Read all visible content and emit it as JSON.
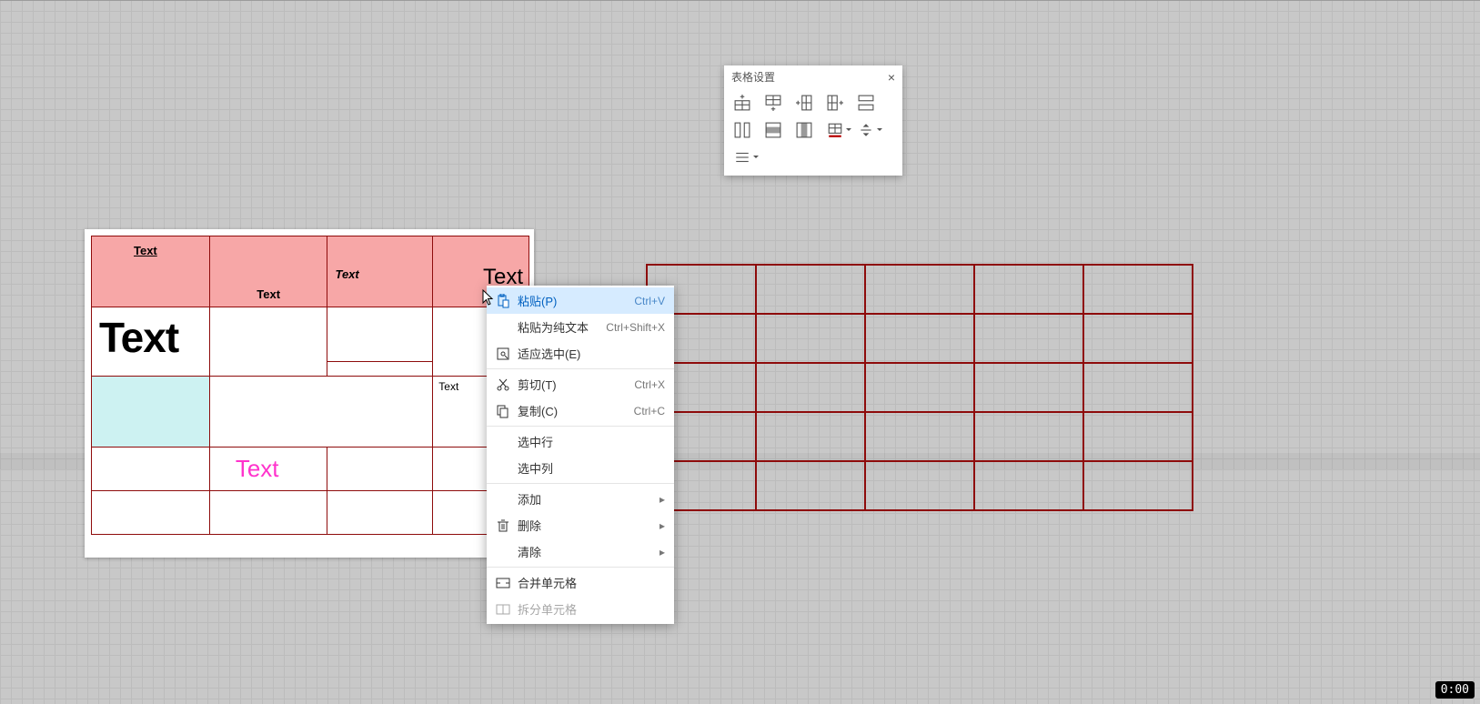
{
  "palette": {
    "title": "表格设置",
    "icons": [
      "insert-row-above-icon",
      "insert-row-below-icon",
      "insert-col-left-icon",
      "insert-col-right-icon",
      "split-horizontal-icon",
      "split-vertical-icon",
      "delete-row-icon",
      "delete-col-icon",
      "border-color-icon",
      "align-vertical-icon",
      "align-horizontal-icon"
    ]
  },
  "left_table": {
    "header": [
      {
        "text": "Text",
        "style": "underline"
      },
      {
        "text": "Text",
        "style": "bottom"
      },
      {
        "text": "Text",
        "style": "italic"
      },
      {
        "text": "Text",
        "style": "large-right"
      }
    ],
    "row2_cell1": "Text",
    "row4_cell4": "Text",
    "row5_cell2": "Text"
  },
  "right_table": {
    "rows": 5,
    "cols": 5
  },
  "context_menu": {
    "items": [
      {
        "icon": "paste-icon",
        "label": "粘贴(P)",
        "kbd": "Ctrl+V",
        "hover": true
      },
      {
        "icon": "",
        "label": "粘贴为纯文本",
        "kbd": "Ctrl+Shift+X"
      },
      {
        "icon": "fit-selection-icon",
        "label": "适应选中(E)",
        "kbd": ""
      },
      {
        "icon": "cut-icon",
        "label": "剪切(T)",
        "kbd": "Ctrl+X"
      },
      {
        "icon": "copy-icon",
        "label": "复制(C)",
        "kbd": "Ctrl+C"
      },
      {
        "icon": "",
        "label": "选中行",
        "kbd": ""
      },
      {
        "icon": "",
        "label": "选中列",
        "kbd": ""
      },
      {
        "icon": "",
        "label": "添加",
        "submenu": true
      },
      {
        "icon": "delete-icon",
        "label": "删除",
        "submenu": true
      },
      {
        "icon": "",
        "label": "清除",
        "submenu": true
      },
      {
        "icon": "merge-cells-icon",
        "label": "合并单元格",
        "kbd": ""
      },
      {
        "icon": "split-cells-icon",
        "label": "拆分单元格",
        "kbd": "",
        "disabled": true
      }
    ],
    "separators_after": [
      2,
      4,
      6,
      9
    ]
  },
  "timestamp": "0:00",
  "colors": {
    "table_border": "#8e0b0b",
    "header_fill": "#f7a7a7",
    "cyan_cell": "#cdf2f2",
    "pink_text": "#ff33cc",
    "menu_hover": "#d6ebff"
  }
}
